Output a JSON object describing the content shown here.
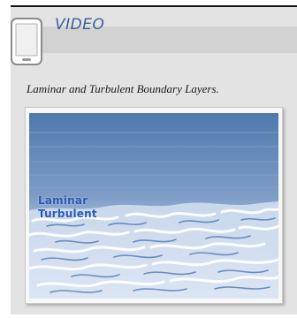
{
  "sidebar": {
    "label": "VIDEO",
    "icon": "mobile-device-icon",
    "colors": {
      "box_background": "#e3e3e3",
      "header_band": "#d2d2d2",
      "label_color": "#3a5f9a"
    }
  },
  "caption": "Laminar and Turbulent Boundary Layers.",
  "video": {
    "labels": {
      "laminar": "Laminar",
      "turbulent": "Turbulent"
    },
    "label_color": "#2a58b6"
  }
}
